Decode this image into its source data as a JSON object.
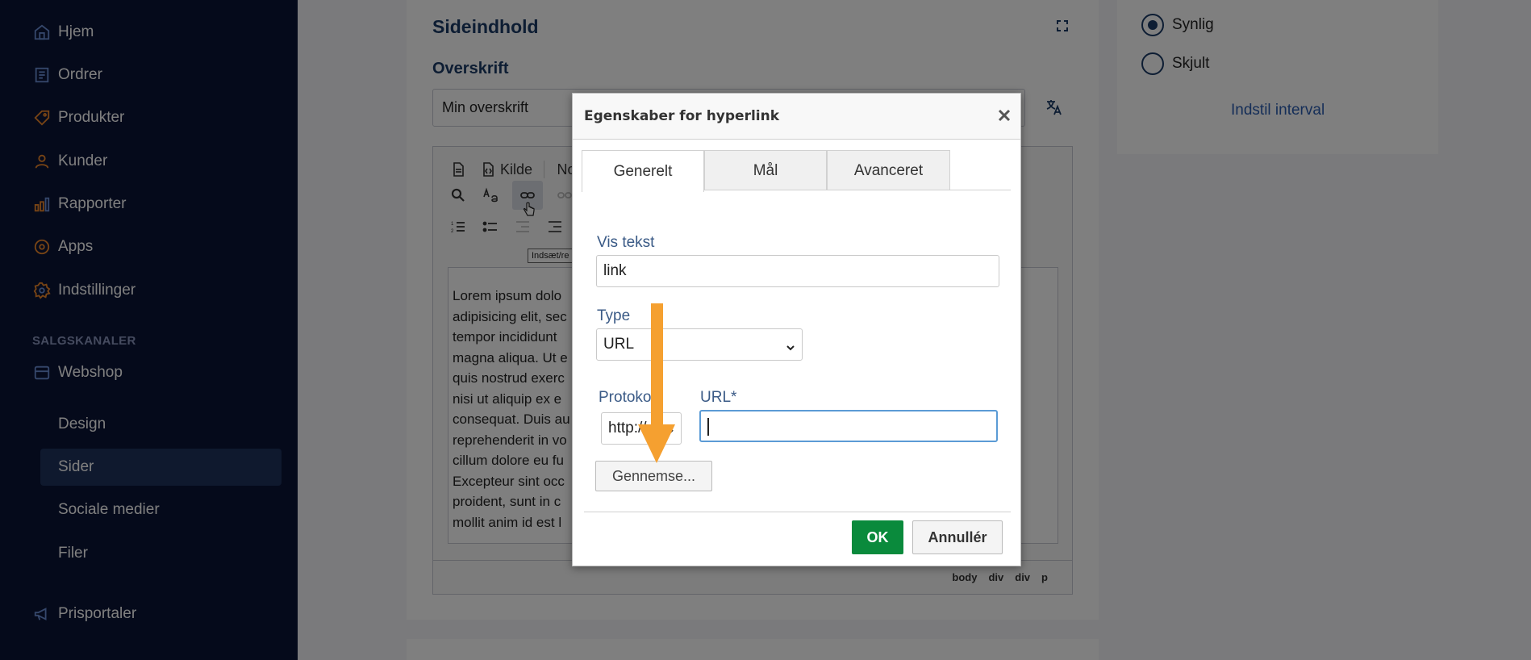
{
  "sidebar": {
    "items": [
      {
        "label": "Hjem",
        "icon": "home-icon"
      },
      {
        "label": "Ordrer",
        "icon": "orders-icon"
      },
      {
        "label": "Produkter",
        "icon": "tag-icon"
      },
      {
        "label": "Kunder",
        "icon": "user-icon"
      },
      {
        "label": "Rapporter",
        "icon": "bar-chart-icon"
      },
      {
        "label": "Apps",
        "icon": "apps-icon"
      },
      {
        "label": "Indstillinger",
        "icon": "gear-icon"
      }
    ],
    "section_label": "SALGSKANALER",
    "webshop": {
      "label": "Webshop",
      "icon": "store-icon"
    },
    "sub_items": [
      {
        "label": "Design"
      },
      {
        "label": "Sider",
        "active": true
      },
      {
        "label": "Sociale medier"
      },
      {
        "label": "Filer"
      }
    ],
    "prisportaler": {
      "label": "Prisportaler",
      "icon": "megaphone-icon"
    }
  },
  "content": {
    "card_title": "Sideindhold",
    "headline_label": "Overskrift",
    "headline_value": "Min overskrift",
    "toolbar": {
      "source_label": "Kilde",
      "partial_label": "No",
      "tooltip": "Indsæt/re"
    },
    "editor_lines": [
      " Lorem ipsum dolo",
      "adipisicing elit, sec",
      "tempor incididunt",
      "magna aliqua. Ut e",
      "quis nostrud exerc",
      "nisi ut aliquip ex e",
      "consequat. Duis au",
      "reprehenderit in vo",
      "cillum dolore eu fu",
      "Excepteur sint occ",
      "proident, sunt in c",
      "mollit anim id est l"
    ],
    "path": [
      "body",
      "div",
      "div",
      "p"
    ]
  },
  "visibility": {
    "visible_label": "Synlig",
    "hidden_label": "Skjult",
    "interval_link": "Indstil interval"
  },
  "dialog": {
    "title": "Egenskaber for hyperlink",
    "tabs": [
      "Generelt",
      "Mål",
      "Avanceret"
    ],
    "display_text_label": "Vis tekst",
    "display_text_value": "link",
    "type_label": "Type",
    "type_value": "URL",
    "protocol_label": "Protoko",
    "protocol_value": "http://",
    "url_label": "URL*",
    "url_value": "",
    "browse_label": "Gennemse...",
    "ok_label": "OK",
    "cancel_label": "Annullér"
  },
  "colors": {
    "sidebar_bg": "#0b1437",
    "accent": "#1b3a66",
    "ok_green": "#0a8a3c",
    "annotation_arrow": "#f5a030",
    "icon_orange": "#f0892b"
  }
}
